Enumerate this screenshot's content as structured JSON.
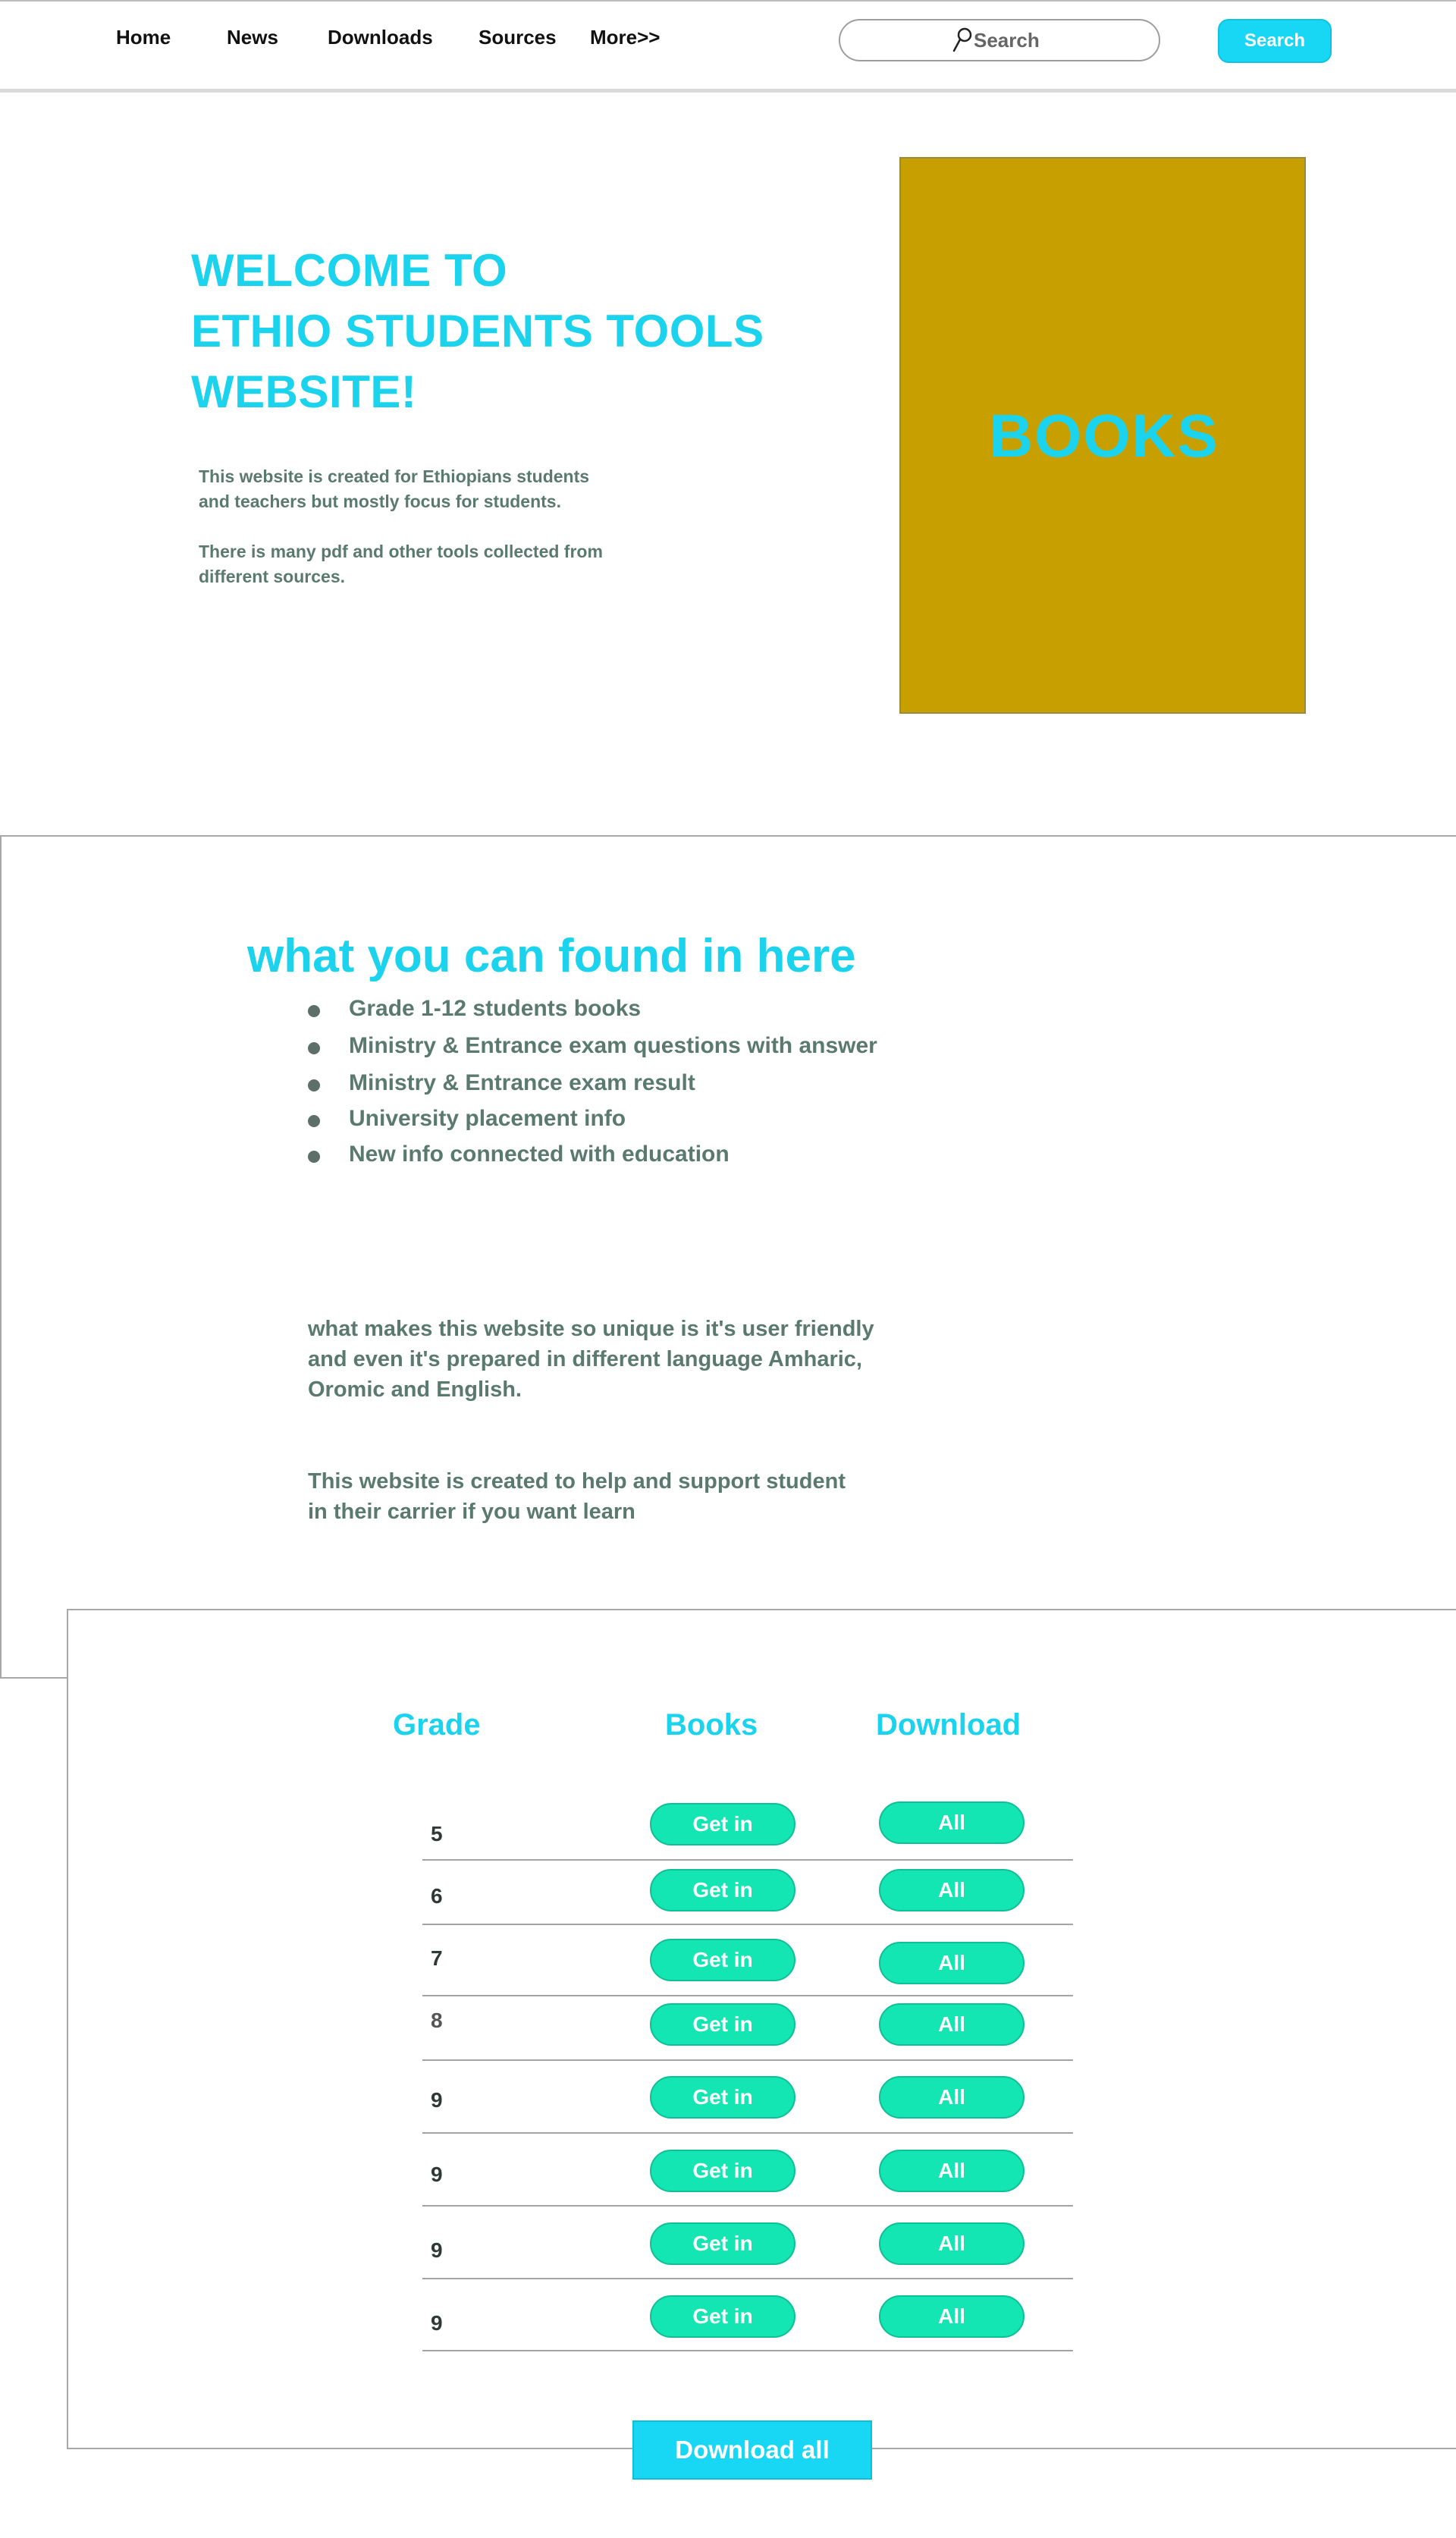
{
  "nav": {
    "items": [
      {
        "label": "Home"
      },
      {
        "label": "News"
      },
      {
        "label": "Downloads"
      },
      {
        "label": "Sources"
      },
      {
        "label": "More>>"
      }
    ],
    "search_placeholder": "Search",
    "search_button_label": "Search",
    "icons": {
      "search": "search-icon"
    }
  },
  "hero": {
    "title_lines": [
      "WELCOME TO",
      "ETHIO STUDENTS TOOLS",
      "WEBSITE!"
    ],
    "paragraph1": [
      "This website is created for Ethiopians  students",
      "and teachers but mostly focus for students."
    ],
    "paragraph2": [
      "There is many pdf and other tools collected from",
      "different sources."
    ],
    "books_panel_label": "BOOKS",
    "books_panel_color": "#c7a000"
  },
  "info": {
    "heading": "what you can found in here",
    "bullets": [
      "Grade 1-12 students books",
      "Ministry & Entrance exam questions with answer",
      "Ministry & Entrance exam result",
      " University placement info",
      "New info connected with education"
    ],
    "paragraph1": [
      "what makes this website so unique is it's user friendly",
      "and even it's prepared in different language Amharic,",
      "Oromic and English."
    ],
    "paragraph2": [
      "This website is created to help and support student",
      "in their carrier if you want learn"
    ]
  },
  "table": {
    "headers": [
      "Grade",
      "Books",
      "Download"
    ],
    "rows": [
      {
        "grade": "5",
        "books": "Get in",
        "download": "All"
      },
      {
        "grade": "6",
        "books": "Get in",
        "download": "All"
      },
      {
        "grade": "7",
        "books": "Get in",
        "download": "All"
      },
      {
        "grade": "8",
        "books": "Get in",
        "download": "All"
      },
      {
        "grade": "9",
        "books": "Get in",
        "download": "All"
      },
      {
        "grade": "9",
        "books": "Get in",
        "download": "All"
      },
      {
        "grade": "9",
        "books": "Get in",
        "download": "All"
      },
      {
        "grade": "9",
        "books": "Get in",
        "download": "All"
      }
    ],
    "download_all_label": "Download all"
  },
  "colors": {
    "accent": "#1cd3ee",
    "pill": "#14e6b3",
    "body_text": "#5b7a6f"
  }
}
